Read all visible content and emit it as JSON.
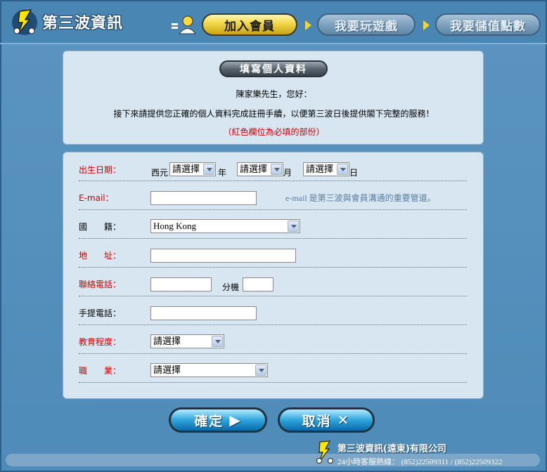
{
  "header": {
    "brand": "第三波資訊",
    "steps": [
      {
        "label": "加入會員",
        "active": true
      },
      {
        "label": "我要玩遊戲",
        "active": false
      },
      {
        "label": "我要儲值點數",
        "active": false
      }
    ]
  },
  "intro_panel": {
    "title": "填寫個人資料",
    "greeting": "陳家樂先生，您好：",
    "message": "接下來請提供您正確的個人資料完成註冊手續，以便第三波日後提供閣下完整的服務！",
    "required_note": "（紅色欄位為必填的部份）"
  },
  "form": {
    "birthday": {
      "label": "出生日期：",
      "era": "西元",
      "year_value": "請選擇",
      "year_unit": "年",
      "month_value": "請選擇",
      "month_unit": "月",
      "day_value": "請選擇",
      "day_unit": "日"
    },
    "email": {
      "label": "E-mail：",
      "value": "",
      "hint": "e-mail 是第三波與會員溝通的重要管道。"
    },
    "nationality": {
      "label": "國　　籍：",
      "value": "Hong Kong"
    },
    "address": {
      "label": "地　　址：",
      "value": ""
    },
    "phone": {
      "label": "聯絡電話：",
      "value": "",
      "ext_label": "分機",
      "ext_value": ""
    },
    "mobile": {
      "label": "手提電話：",
      "value": ""
    },
    "education": {
      "label": "教育程度：",
      "value": "請選擇"
    },
    "occupation": {
      "label": "職　　業：",
      "value": "請選擇"
    }
  },
  "buttons": {
    "ok_label": "確定",
    "ok_icon": "▶",
    "cancel_label": "取消",
    "cancel_icon": "✕"
  },
  "footer": {
    "company": "第三波資訊(遠東)有限公司",
    "hotline": "24小時客服熱線： (852)22509311 / (852)22509322"
  },
  "colors": {
    "background": "#4a86b4",
    "panel": "#d7e6f1",
    "required": "#cc0000",
    "active_step": "#f2d648",
    "button": "#2fa5dd"
  }
}
